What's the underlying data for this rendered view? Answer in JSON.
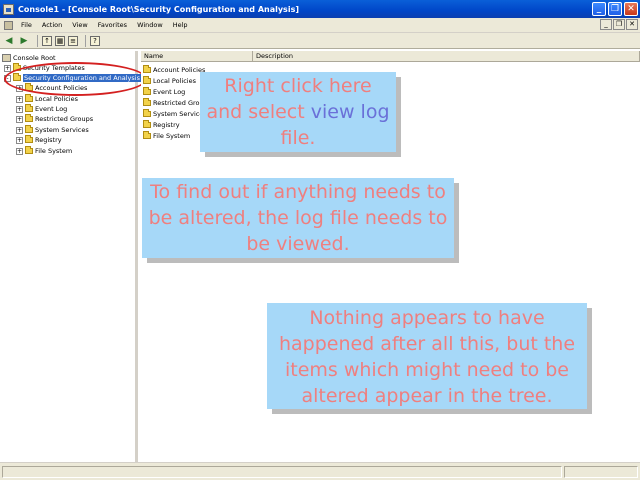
{
  "window": {
    "title": "Console1 - [Console Root\\Security Configuration and Analysis]"
  },
  "menu": {
    "items": [
      "File",
      "Action",
      "View",
      "Favorites",
      "Window",
      "Help"
    ]
  },
  "tree": {
    "root": "Console Root",
    "items": [
      {
        "label": "Security Templates",
        "expander": "+"
      },
      {
        "label": "Security Configuration and Analysis",
        "expander": "-",
        "selected": true
      },
      {
        "label": "Account Policies",
        "expander": "+"
      },
      {
        "label": "Local Policies",
        "expander": "+"
      },
      {
        "label": "Event Log",
        "expander": "+"
      },
      {
        "label": "Restricted Groups",
        "expander": "+"
      },
      {
        "label": "System Services",
        "expander": "+"
      },
      {
        "label": "Registry",
        "expander": "+"
      },
      {
        "label": "File System",
        "expander": "+"
      }
    ]
  },
  "list": {
    "columns": [
      "Name",
      "Description"
    ],
    "items": [
      "Account Policies",
      "Local Policies",
      "Event Log",
      "Restricted Groups",
      "System Services",
      "Registry",
      "File System"
    ]
  },
  "callouts": {
    "first": {
      "line1": "Right click here",
      "line2_prefix": "and select ",
      "line2_link": "view log",
      "line3": "file."
    },
    "second": "To find out if anything needs to be altered, the log file needs to be viewed.",
    "third": "Nothing appears to have happened after all this, but  the items which might need to be altered appear in the tree."
  }
}
